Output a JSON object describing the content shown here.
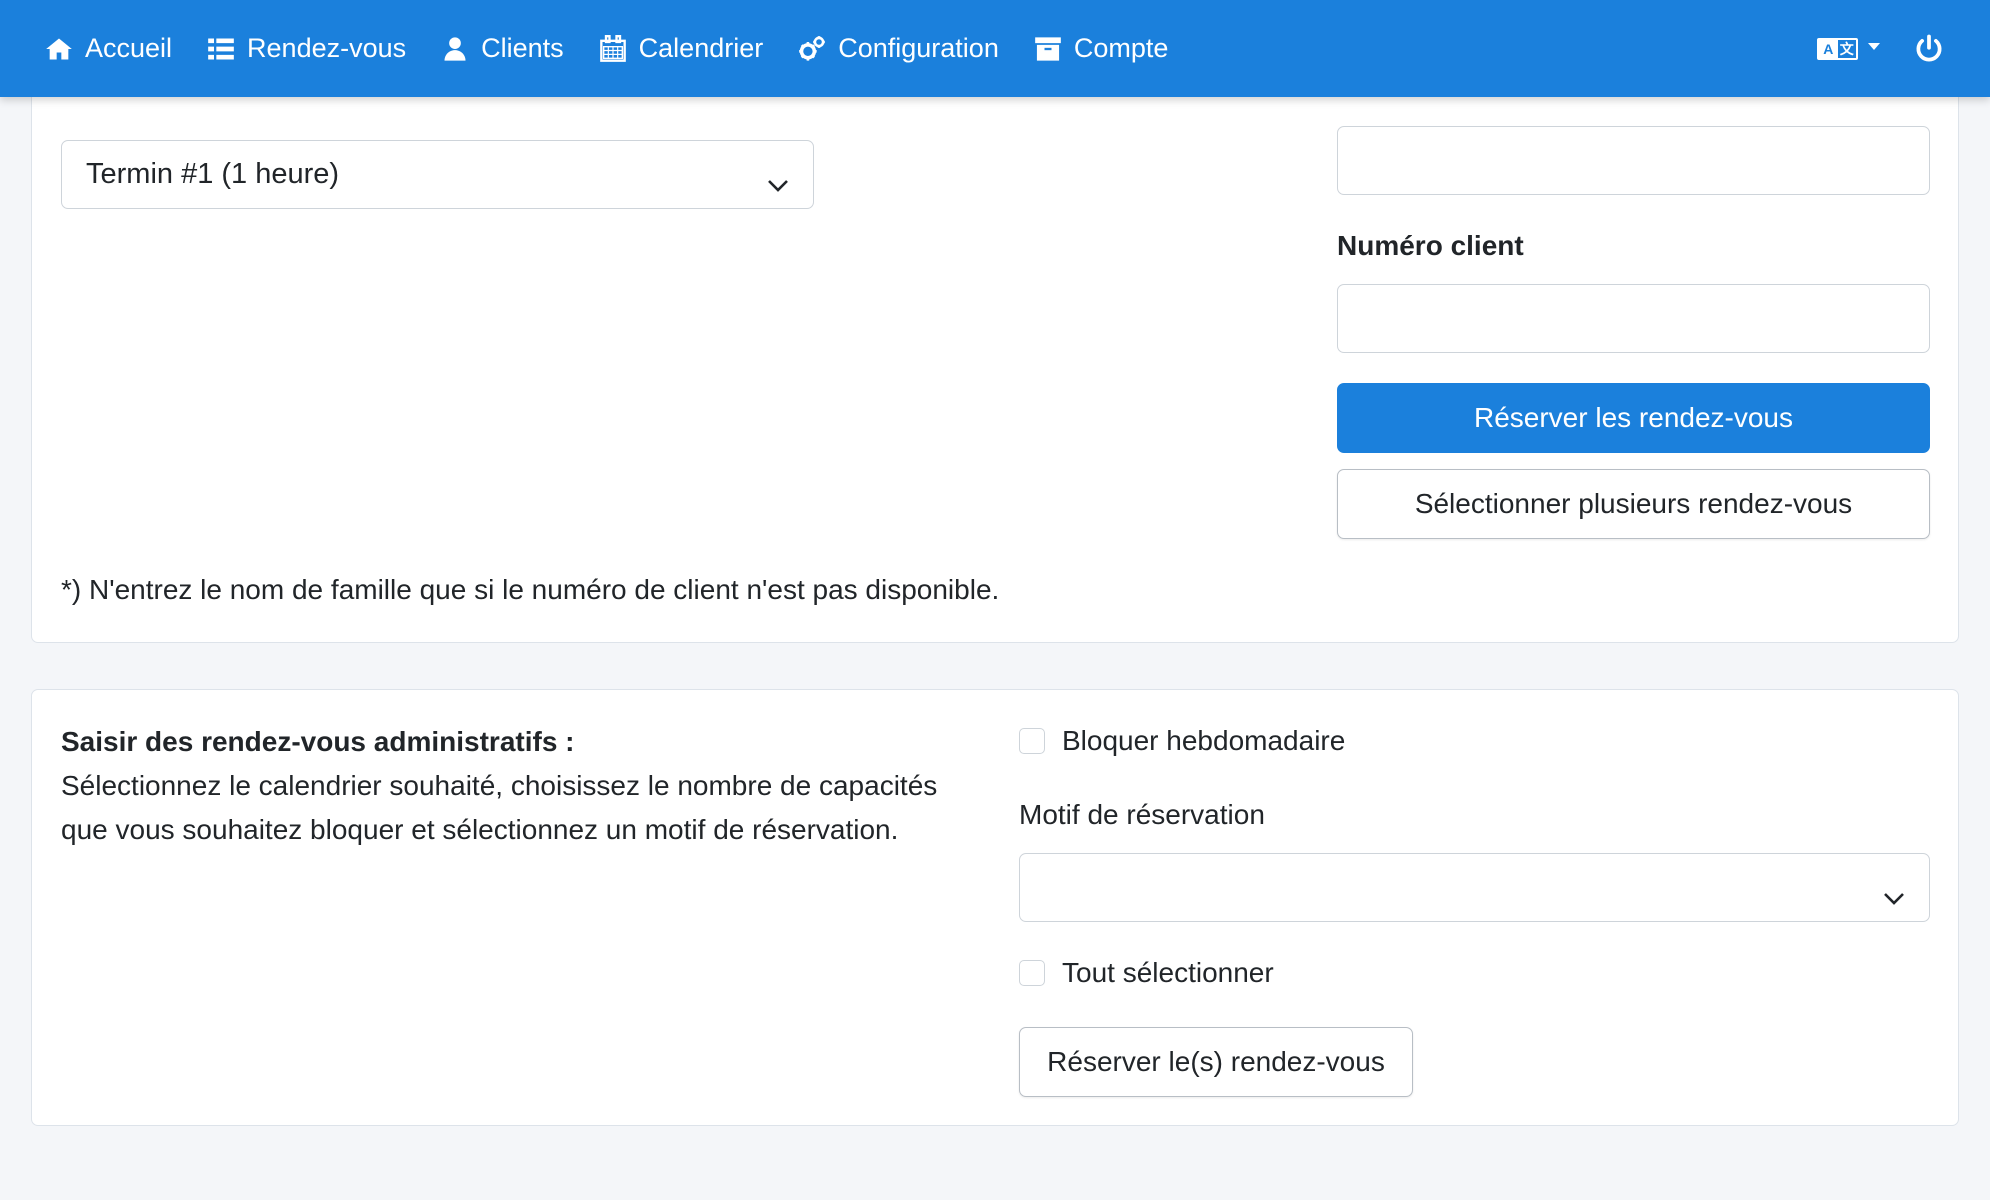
{
  "nav": {
    "items": [
      {
        "label": "Accueil",
        "icon": "home-icon"
      },
      {
        "label": "Rendez-vous",
        "icon": "list-icon"
      },
      {
        "label": "Clients",
        "icon": "user-icon"
      },
      {
        "label": "Calendrier",
        "icon": "calendar-icon"
      },
      {
        "label": "Configuration",
        "icon": "cogs-icon"
      },
      {
        "label": "Compte",
        "icon": "archive-icon"
      }
    ],
    "language_icon": "language-icon",
    "logout_icon": "power-icon",
    "background": "#1b80dc"
  },
  "booking": {
    "appointment_type_selected": "Termin #1 (1 heure)",
    "lastname_value": "",
    "customer_number_label": "Numéro client",
    "customer_number_value": "",
    "book_button": "Réserver les rendez-vous",
    "select_multiple_button": "Sélectionner plusieurs rendez-vous",
    "footnote": "*) N'entrez le nom de famille que si le numéro de client n'est pas disponible."
  },
  "admin": {
    "title": "Saisir des rendez-vous administratifs :",
    "description": "Sélectionnez le calendrier souhaité, choisissez le nombre de capacités que vous souhaitez bloquer et sélectionnez un motif de réservation.",
    "weekly_block_label": "Bloquer hebdomadaire",
    "weekly_block_checked": false,
    "reason_label": "Motif de réservation",
    "reason_selected": "",
    "select_all_label": "Tout sélectionner",
    "select_all_checked": false,
    "book_button": "Réserver le(s) rendez-vous"
  }
}
